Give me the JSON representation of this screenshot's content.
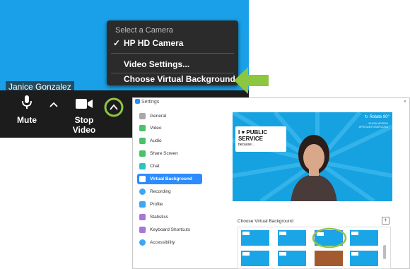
{
  "zoom": {
    "participant_name": "Janice Gonzalez",
    "toolbar": {
      "mute_label": "Mute",
      "stop_video_label": "Stop Video"
    },
    "camera_menu": {
      "header": "Select a Camera",
      "items": [
        {
          "label": "HP HD Camera",
          "checked": true
        },
        {
          "label": "Video Settings..."
        },
        {
          "label": "Choose Virtual Background"
        }
      ]
    },
    "highlight_color": "#8dc63f"
  },
  "settings": {
    "title": "Settings",
    "sidebar": [
      {
        "label": "General",
        "icon": "gear-icon",
        "color": "#a8a8a8"
      },
      {
        "label": "Video",
        "icon": "video-icon",
        "color": "#49c16d"
      },
      {
        "label": "Audio",
        "icon": "headphones-icon",
        "color": "#49c16d"
      },
      {
        "label": "Share Screen",
        "icon": "share-screen-icon",
        "color": "#49c16d"
      },
      {
        "label": "Chat",
        "icon": "chat-icon",
        "color": "#2fc3c3"
      },
      {
        "label": "Virtual Background",
        "icon": "person-icon",
        "color": "#ffffff",
        "active": true
      },
      {
        "label": "Recording",
        "icon": "record-icon",
        "color": "#3ea6f5"
      },
      {
        "label": "Profile",
        "icon": "profile-icon",
        "color": "#3ea6f5"
      },
      {
        "label": "Statistics",
        "icon": "statistics-icon",
        "color": "#a875d9"
      },
      {
        "label": "Keyboard Shortcuts",
        "icon": "keyboard-icon",
        "color": "#a875d9"
      },
      {
        "label": "Accessibility",
        "icon": "accessibility-icon",
        "color": "#3ea6f5"
      }
    ],
    "preview": {
      "bubble_line1": "I ♥ PUBLIC",
      "bubble_line2": "SERVICE",
      "bubble_line3": "because...",
      "rotate_label": "Rotate 90°",
      "corner_line1": "SHOW #PSRW",
      "corner_line2": "#PROUDTOSERVUSA"
    },
    "choose_label": "Choose Virtual Background",
    "add_label": "+"
  }
}
